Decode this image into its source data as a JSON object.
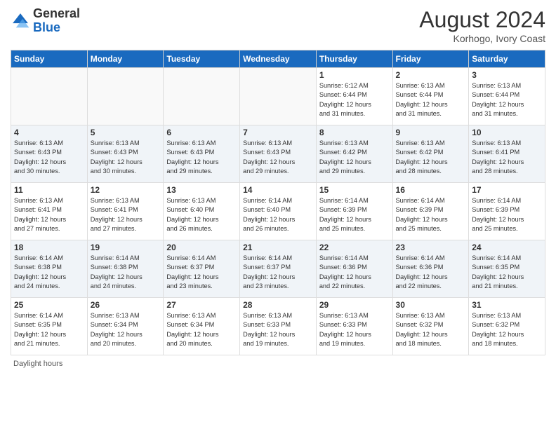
{
  "header": {
    "logo_general": "General",
    "logo_blue": "Blue",
    "title": "August 2024",
    "subtitle": "Korhogo, Ivory Coast"
  },
  "footer": {
    "daylight_label": "Daylight hours"
  },
  "weekdays": [
    "Sunday",
    "Monday",
    "Tuesday",
    "Wednesday",
    "Thursday",
    "Friday",
    "Saturday"
  ],
  "weeks": [
    [
      {
        "day": "",
        "info": ""
      },
      {
        "day": "",
        "info": ""
      },
      {
        "day": "",
        "info": ""
      },
      {
        "day": "",
        "info": ""
      },
      {
        "day": "1",
        "info": "Sunrise: 6:12 AM\nSunset: 6:44 PM\nDaylight: 12 hours\nand 31 minutes."
      },
      {
        "day": "2",
        "info": "Sunrise: 6:13 AM\nSunset: 6:44 PM\nDaylight: 12 hours\nand 31 minutes."
      },
      {
        "day": "3",
        "info": "Sunrise: 6:13 AM\nSunset: 6:44 PM\nDaylight: 12 hours\nand 31 minutes."
      }
    ],
    [
      {
        "day": "4",
        "info": "Sunrise: 6:13 AM\nSunset: 6:43 PM\nDaylight: 12 hours\nand 30 minutes."
      },
      {
        "day": "5",
        "info": "Sunrise: 6:13 AM\nSunset: 6:43 PM\nDaylight: 12 hours\nand 30 minutes."
      },
      {
        "day": "6",
        "info": "Sunrise: 6:13 AM\nSunset: 6:43 PM\nDaylight: 12 hours\nand 29 minutes."
      },
      {
        "day": "7",
        "info": "Sunrise: 6:13 AM\nSunset: 6:43 PM\nDaylight: 12 hours\nand 29 minutes."
      },
      {
        "day": "8",
        "info": "Sunrise: 6:13 AM\nSunset: 6:42 PM\nDaylight: 12 hours\nand 29 minutes."
      },
      {
        "day": "9",
        "info": "Sunrise: 6:13 AM\nSunset: 6:42 PM\nDaylight: 12 hours\nand 28 minutes."
      },
      {
        "day": "10",
        "info": "Sunrise: 6:13 AM\nSunset: 6:41 PM\nDaylight: 12 hours\nand 28 minutes."
      }
    ],
    [
      {
        "day": "11",
        "info": "Sunrise: 6:13 AM\nSunset: 6:41 PM\nDaylight: 12 hours\nand 27 minutes."
      },
      {
        "day": "12",
        "info": "Sunrise: 6:13 AM\nSunset: 6:41 PM\nDaylight: 12 hours\nand 27 minutes."
      },
      {
        "day": "13",
        "info": "Sunrise: 6:13 AM\nSunset: 6:40 PM\nDaylight: 12 hours\nand 26 minutes."
      },
      {
        "day": "14",
        "info": "Sunrise: 6:14 AM\nSunset: 6:40 PM\nDaylight: 12 hours\nand 26 minutes."
      },
      {
        "day": "15",
        "info": "Sunrise: 6:14 AM\nSunset: 6:39 PM\nDaylight: 12 hours\nand 25 minutes."
      },
      {
        "day": "16",
        "info": "Sunrise: 6:14 AM\nSunset: 6:39 PM\nDaylight: 12 hours\nand 25 minutes."
      },
      {
        "day": "17",
        "info": "Sunrise: 6:14 AM\nSunset: 6:39 PM\nDaylight: 12 hours\nand 25 minutes."
      }
    ],
    [
      {
        "day": "18",
        "info": "Sunrise: 6:14 AM\nSunset: 6:38 PM\nDaylight: 12 hours\nand 24 minutes."
      },
      {
        "day": "19",
        "info": "Sunrise: 6:14 AM\nSunset: 6:38 PM\nDaylight: 12 hours\nand 24 minutes."
      },
      {
        "day": "20",
        "info": "Sunrise: 6:14 AM\nSunset: 6:37 PM\nDaylight: 12 hours\nand 23 minutes."
      },
      {
        "day": "21",
        "info": "Sunrise: 6:14 AM\nSunset: 6:37 PM\nDaylight: 12 hours\nand 23 minutes."
      },
      {
        "day": "22",
        "info": "Sunrise: 6:14 AM\nSunset: 6:36 PM\nDaylight: 12 hours\nand 22 minutes."
      },
      {
        "day": "23",
        "info": "Sunrise: 6:14 AM\nSunset: 6:36 PM\nDaylight: 12 hours\nand 22 minutes."
      },
      {
        "day": "24",
        "info": "Sunrise: 6:14 AM\nSunset: 6:35 PM\nDaylight: 12 hours\nand 21 minutes."
      }
    ],
    [
      {
        "day": "25",
        "info": "Sunrise: 6:14 AM\nSunset: 6:35 PM\nDaylight: 12 hours\nand 21 minutes."
      },
      {
        "day": "26",
        "info": "Sunrise: 6:13 AM\nSunset: 6:34 PM\nDaylight: 12 hours\nand 20 minutes."
      },
      {
        "day": "27",
        "info": "Sunrise: 6:13 AM\nSunset: 6:34 PM\nDaylight: 12 hours\nand 20 minutes."
      },
      {
        "day": "28",
        "info": "Sunrise: 6:13 AM\nSunset: 6:33 PM\nDaylight: 12 hours\nand 19 minutes."
      },
      {
        "day": "29",
        "info": "Sunrise: 6:13 AM\nSunset: 6:33 PM\nDaylight: 12 hours\nand 19 minutes."
      },
      {
        "day": "30",
        "info": "Sunrise: 6:13 AM\nSunset: 6:32 PM\nDaylight: 12 hours\nand 18 minutes."
      },
      {
        "day": "31",
        "info": "Sunrise: 6:13 AM\nSunset: 6:32 PM\nDaylight: 12 hours\nand 18 minutes."
      }
    ]
  ]
}
